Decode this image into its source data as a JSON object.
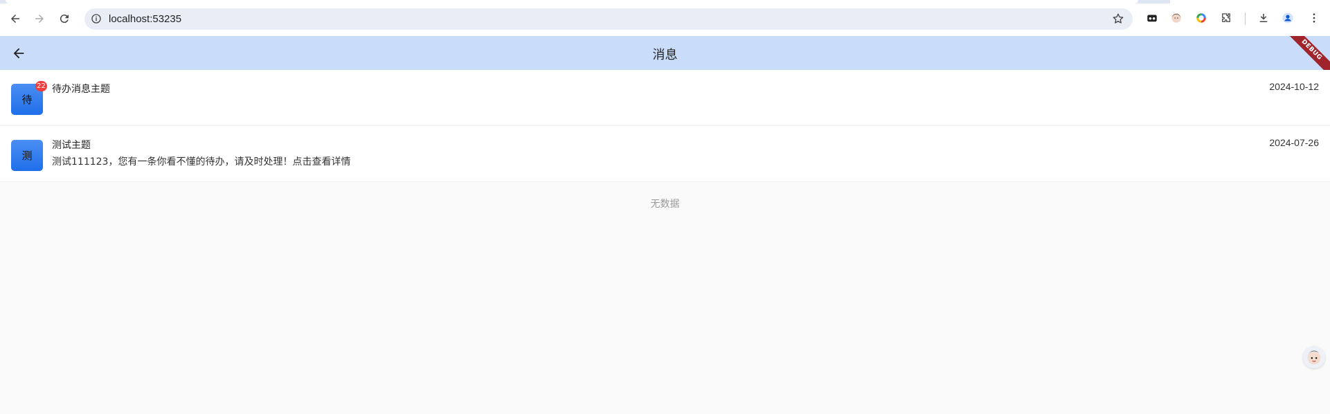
{
  "browser": {
    "url": "localhost:53235"
  },
  "appbar": {
    "title": "消息",
    "debug_label": "DEBUG"
  },
  "messages": [
    {
      "avatar_char": "待",
      "badge": "22",
      "subject": "待办消息主题",
      "content": "",
      "date": "2024-10-12"
    },
    {
      "avatar_char": "测",
      "badge": "",
      "subject": "测试主题",
      "content": "测试111123，您有一条你看不懂的待办，请及时处理！点击查看详情",
      "date": "2024-07-26"
    }
  ],
  "empty_text": "无数据",
  "colors": {
    "appbar_bg": "#c9ddfb",
    "avatar_blue": "#2f7cf0",
    "badge_red": "#f23b3b",
    "debug_ribbon": "#a0242c"
  }
}
